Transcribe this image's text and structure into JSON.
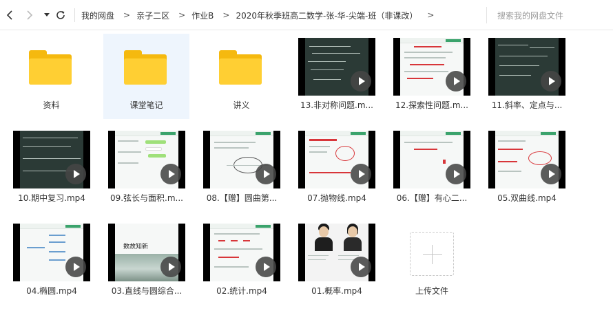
{
  "breadcrumb": [
    "我的网盘",
    "亲子二区",
    "作业B",
    "2020年秋季班高二数学-张-华-尖端-班（非课改）"
  ],
  "search": {
    "placeholder": "搜索我的网盘文件"
  },
  "folders": [
    {
      "label": "资料"
    },
    {
      "label": "课堂笔记"
    },
    {
      "label": "讲义"
    }
  ],
  "videos": [
    {
      "label": "13.非对称问题.m...",
      "style": "board"
    },
    {
      "label": "12.探索性问题.m...",
      "style": "slide"
    },
    {
      "label": "11.斜率、定点与...",
      "style": "board"
    },
    {
      "label": "10.期中复习.mp4",
      "style": "board"
    },
    {
      "label": "09.弦长与面积.m...",
      "style": "slide"
    },
    {
      "label": "08.【赠】圆曲第...",
      "style": "slide"
    },
    {
      "label": "07.抛物线.mp4",
      "style": "slide"
    },
    {
      "label": "06.【赠】有心二...",
      "style": "slide"
    },
    {
      "label": "05.双曲线.mp4",
      "style": "slide"
    },
    {
      "label": "04.椭圆.mp4",
      "style": "slide"
    },
    {
      "label": "03.直线与圆综合...",
      "style": "slide"
    },
    {
      "label": "02.统计.mp4",
      "style": "slide"
    },
    {
      "label": "01.概率.mp4",
      "style": "slide"
    }
  ],
  "upload": {
    "label": "上传文件"
  },
  "thumb_text": {
    "v03": "数故知新"
  },
  "colors": {
    "folder": "#ffcf33",
    "selected_bg": "#eef5fd",
    "accent_red": "#d8363a"
  }
}
